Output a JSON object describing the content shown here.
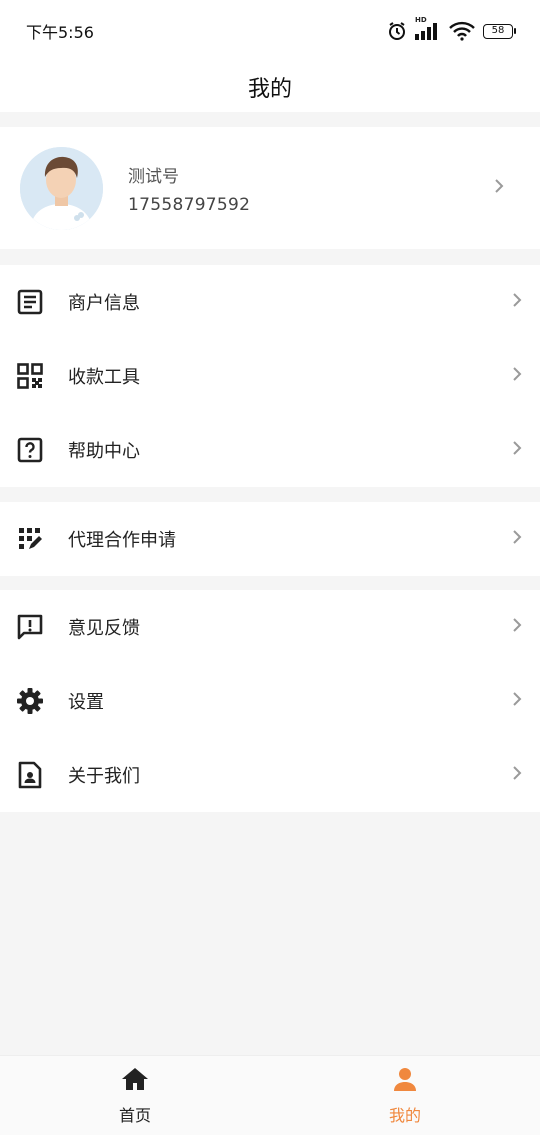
{
  "status_bar": {
    "time": "下午5:56",
    "battery": "58",
    "network_label": "HD"
  },
  "header": {
    "title": "我的"
  },
  "profile": {
    "name": "测试号",
    "phone": "17558797592"
  },
  "menu_groups": [
    [
      {
        "label": "商户信息",
        "icon": "document-list-icon"
      },
      {
        "label": "收款工具",
        "icon": "qr-code-icon"
      },
      {
        "label": "帮助中心",
        "icon": "help-box-icon"
      }
    ],
    [
      {
        "label": "代理合作申请",
        "icon": "apply-edit-icon"
      }
    ],
    [
      {
        "label": "意见反馈",
        "icon": "feedback-icon"
      },
      {
        "label": "设置",
        "icon": "gear-icon"
      },
      {
        "label": "关于我们",
        "icon": "contact-card-icon"
      }
    ]
  ],
  "bottom_nav": {
    "tabs": [
      {
        "label": "首页",
        "icon": "home-icon",
        "active": false
      },
      {
        "label": "我的",
        "icon": "person-icon",
        "active": true
      }
    ]
  },
  "colors": {
    "accent": "#f0883e",
    "icon": "#222222",
    "chevron": "#9a9a9a",
    "background": "#f5f5f5"
  }
}
